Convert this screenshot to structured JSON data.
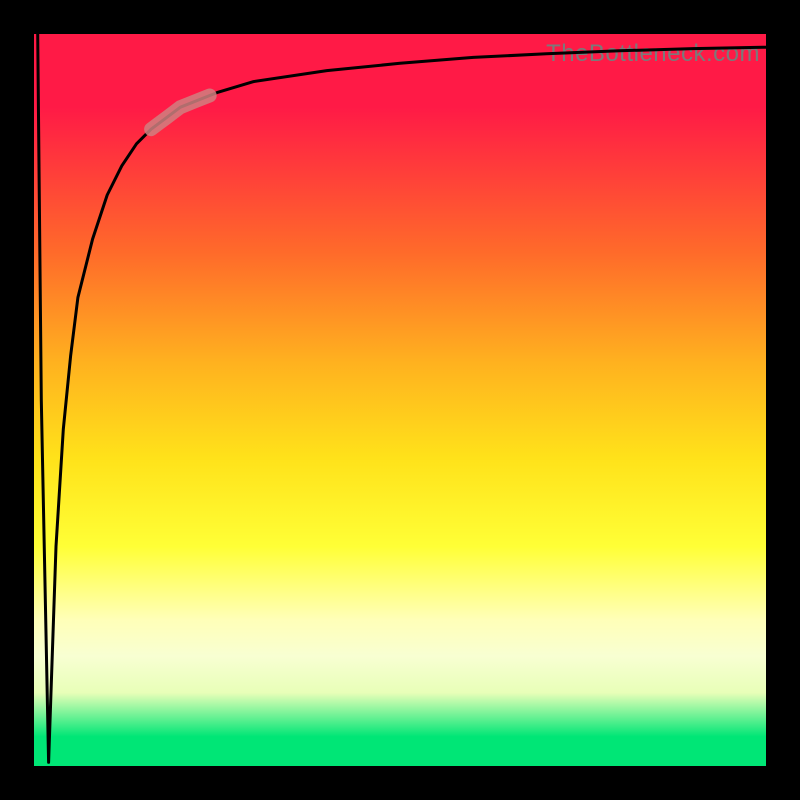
{
  "watermark": "TheBottleneck.com",
  "chart_data": {
    "type": "line",
    "title": "",
    "xlabel": "",
    "ylabel": "",
    "xlim": [
      0,
      100
    ],
    "ylim": [
      0,
      100
    ],
    "x": [
      0.5,
      1,
      2,
      3,
      4,
      5,
      6,
      8,
      10,
      12,
      14,
      16,
      20,
      25,
      30,
      40,
      50,
      60,
      70,
      80,
      90,
      100
    ],
    "values": [
      100,
      50,
      0.5,
      30,
      46,
      56,
      64,
      72,
      78,
      82,
      85,
      87,
      90,
      92,
      93.5,
      95,
      96,
      96.8,
      97.3,
      97.7,
      98,
      98.2
    ],
    "highlight_segment": {
      "x_start": 16,
      "x_end": 24
    },
    "notes": "Values are unitless percentages estimated from the rendered curve. The curve drops sharply from the top-left to near the bottom (x≈2) then rises logarithmically toward an upper asymptote near y≈98. A short reddish highlight overlays the curve roughly between x=16 and x=24."
  }
}
